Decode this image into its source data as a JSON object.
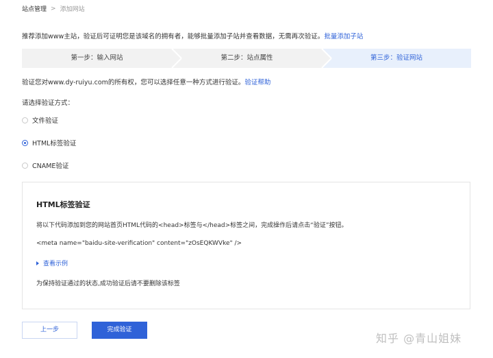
{
  "breadcrumb": {
    "root": "站点管理",
    "separator": ">",
    "current": "添加网站"
  },
  "intro": {
    "text": "推荐添加www主站，验证后可证明您是该域名的拥有者，能够批量添加子站并查看数据，无需再次验证。",
    "link": "批量添加子站"
  },
  "steps": [
    {
      "label": "第一步：输入网站",
      "state": "done"
    },
    {
      "label": "第二步：站点属性",
      "state": "done"
    },
    {
      "label": "第三步：验证网站",
      "state": "active"
    }
  ],
  "verify": {
    "text": "验证您对www.dy-ruiyu.com的所有权，您可以选择任意一种方式进行验证。",
    "help_link": "验证帮助"
  },
  "method_prompt": "请选择验证方式：",
  "methods": [
    {
      "label": "文件验证",
      "checked": false
    },
    {
      "label": "HTML标签验证",
      "checked": true
    },
    {
      "label": "CNAME验证",
      "checked": false
    }
  ],
  "panel": {
    "title": "HTML标签验证",
    "instruction": "将以下代码添加到您的网站首页HTML代码的<head>标签与</head>标签之间，完成操作后请点击“验证”按钮。",
    "code": "<meta name=\"baidu-site-verification\" content=\"zOsEQKWVke\" />",
    "example_link": "查看示例",
    "note": "为保持验证通过的状态,成功验证后请不要删除该标签"
  },
  "buttons": {
    "prev": "上一步",
    "done": "完成验证"
  },
  "watermark": "知乎 @青山姐妹",
  "colors": {
    "accent": "#2f62d8",
    "step_done_bg": "#f2f2f2",
    "step_active_bg": "#e8f0fc"
  }
}
